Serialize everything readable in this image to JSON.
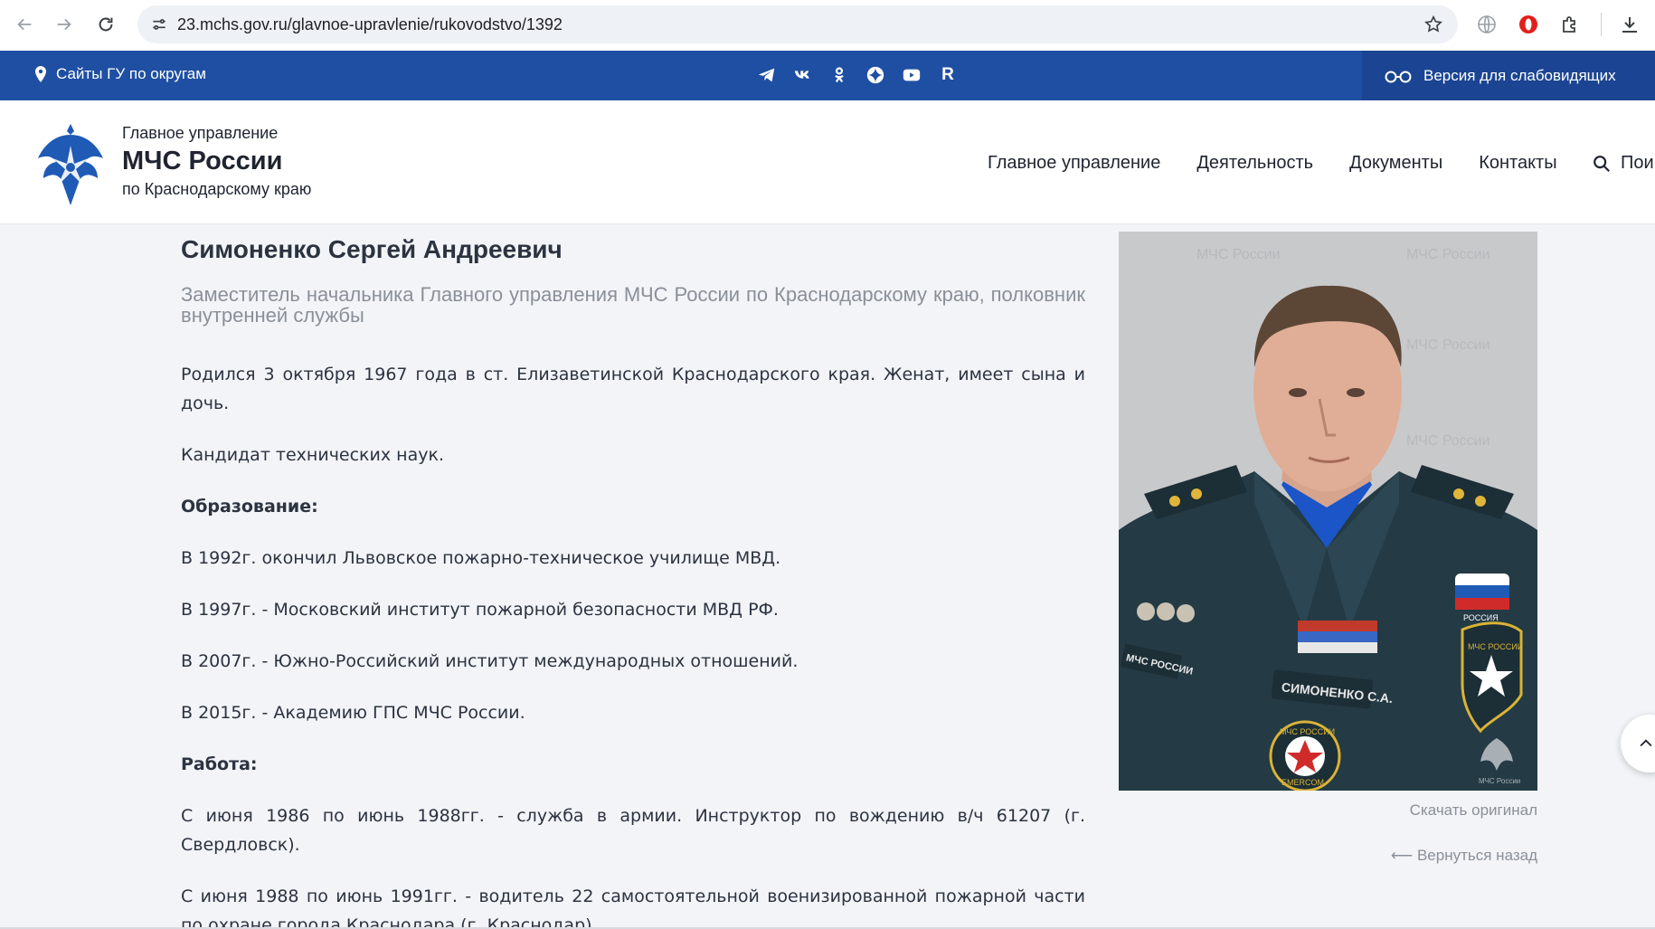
{
  "browser": {
    "url": "23.mchs.gov.ru/glavnoe-upravlenie/rukovodstvo/1392"
  },
  "topbar": {
    "sites_label": "Сайты ГУ по округам",
    "social_icons": [
      "telegram-icon",
      "vk-icon",
      "odnoklassniki-icon",
      "dzen-icon",
      "youtube-icon",
      "rutube-icon"
    ],
    "rutube_letter": "R",
    "vision_label": "Версия для слабовидящих"
  },
  "header": {
    "org_line1": "Главное управление",
    "org_line2": "МЧС России",
    "org_line3": "по Краснодарскому краю",
    "nav": [
      "Главное управление",
      "Деятельность",
      "Документы",
      "Контакты"
    ],
    "search_label": "Пои"
  },
  "profile": {
    "name": "Симоненко Сергей Андреевич",
    "position": "Заместитель начальника Главного управления МЧС России по Краснодарскому краю, полковник внутренней службы",
    "paragraphs": [
      "Родился 3 октября 1967 года в ст. Елизаветинской Краснодарского края. Женат, имеет сына и дочь.",
      "Кандидат технических наук.",
      "Образование:",
      "В 1992г. окончил Львовское пожарно-техническое училище МВД.",
      "В 1997г. - Московский институт пожарной безопасности МВД РФ.",
      "В 2007г. - Южно-Российский институт международных отношений.",
      "В 2015г. - Академию ГПС МЧС России.",
      "Работа:",
      "С июня 1986 по июнь 1988гг. - служба в армии. Инструктор по вождению в/ч 61207 (г. Свердловск).",
      "С июня 1988 по июнь 1991гг. - водитель 22 самостоятельной военизированной пожарной части по охране города Краснодара (г. Краснодар)."
    ],
    "photo": {
      "name_tag": "СИМОНЕНКО С.А.",
      "chest_tag": "МЧС РОССИИ",
      "flag_tag": "РОССИЯ",
      "patch_text": "МЧС РОССИИ",
      "badge_text": "МЧС РОССИИ",
      "emercom_text": "EMERCOM",
      "watermark": "МЧС России",
      "corner_logo_text": "МЧС России"
    },
    "download_label": "Скачать оригинал",
    "back_label": "⟵ Вернуться назад"
  },
  "colors": {
    "topbar": "#1f4fa3",
    "vision_bg": "#1b4592",
    "uniform": "#243a44",
    "photo_bg": "#c8c9cb"
  }
}
